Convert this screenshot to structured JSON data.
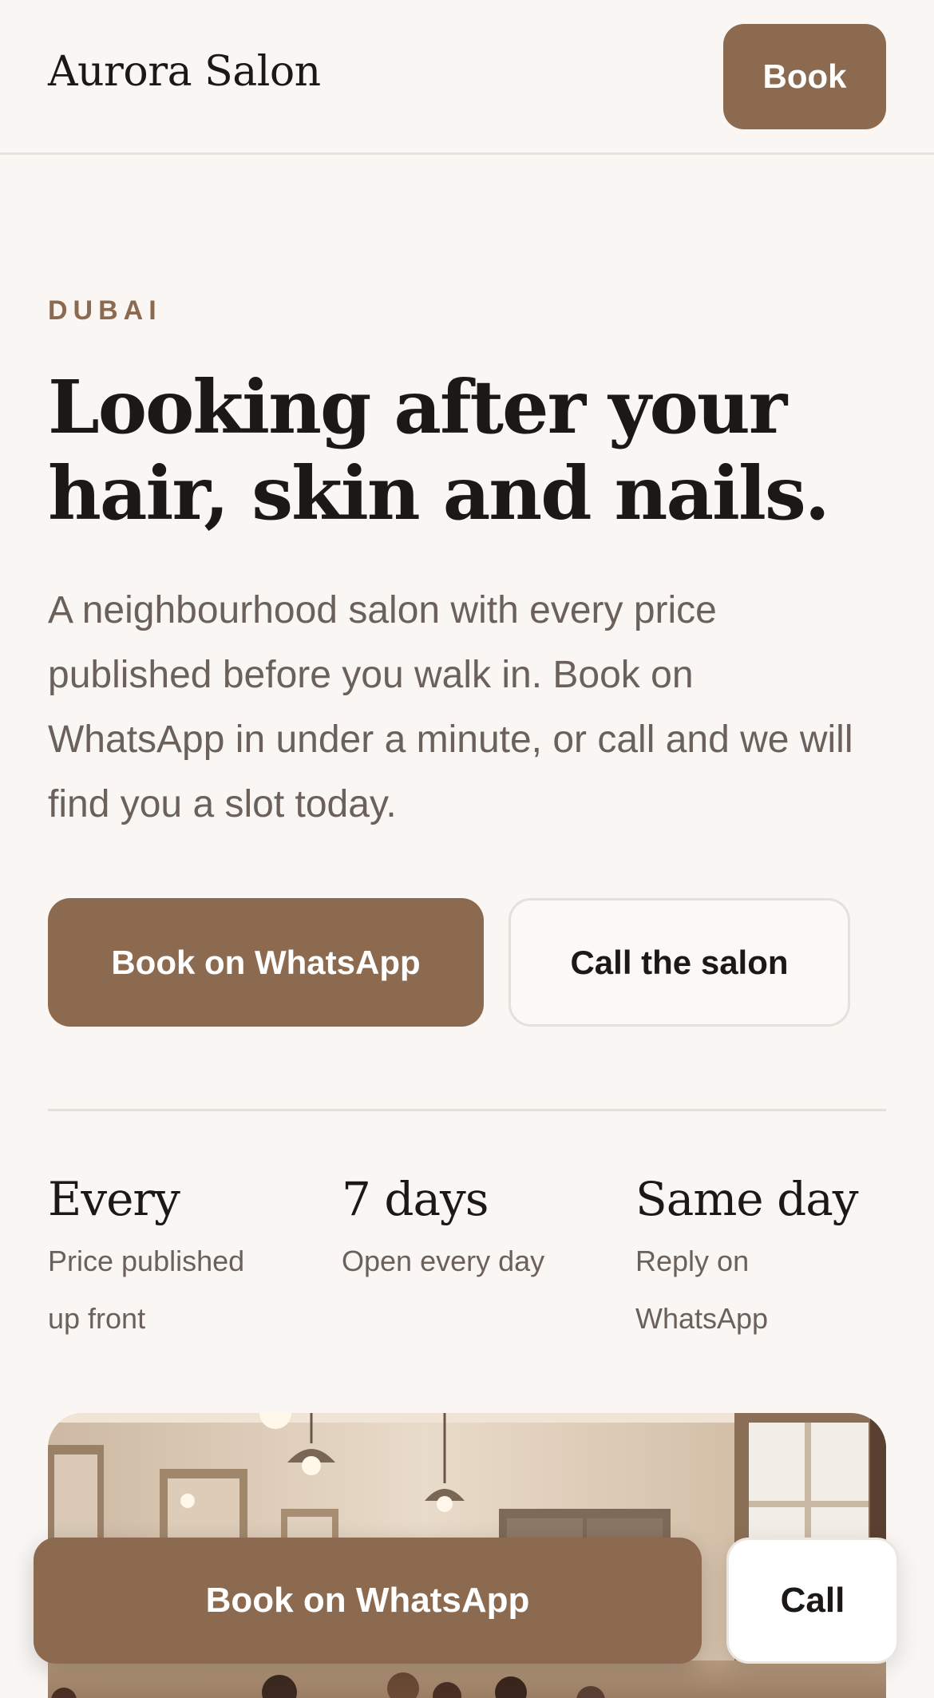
{
  "header": {
    "brand": "Aurora Salon",
    "book_label": "Book"
  },
  "hero": {
    "eyebrow": "DUBAI",
    "title": "Looking after your hair, skin and nails.",
    "description": "A neighbourhood salon with every price published before you walk in. Book on WhatsApp in under a minute, or call and we will find you a slot today.",
    "primary_cta": "Book on WhatsApp",
    "secondary_cta": "Call the salon"
  },
  "stats": [
    {
      "value": "Every",
      "label": "Price published up front"
    },
    {
      "value": "7 days",
      "label": "Open every day"
    },
    {
      "value": "Same day",
      "label": "Reply on WhatsApp"
    }
  ],
  "sticky_bar": {
    "book_label": "Book on WhatsApp",
    "call_label": "Call"
  },
  "colors": {
    "background": "#f9f6f3",
    "accent": "#8c6a4f",
    "text": "#1c1815",
    "muted": "#6b615a"
  }
}
